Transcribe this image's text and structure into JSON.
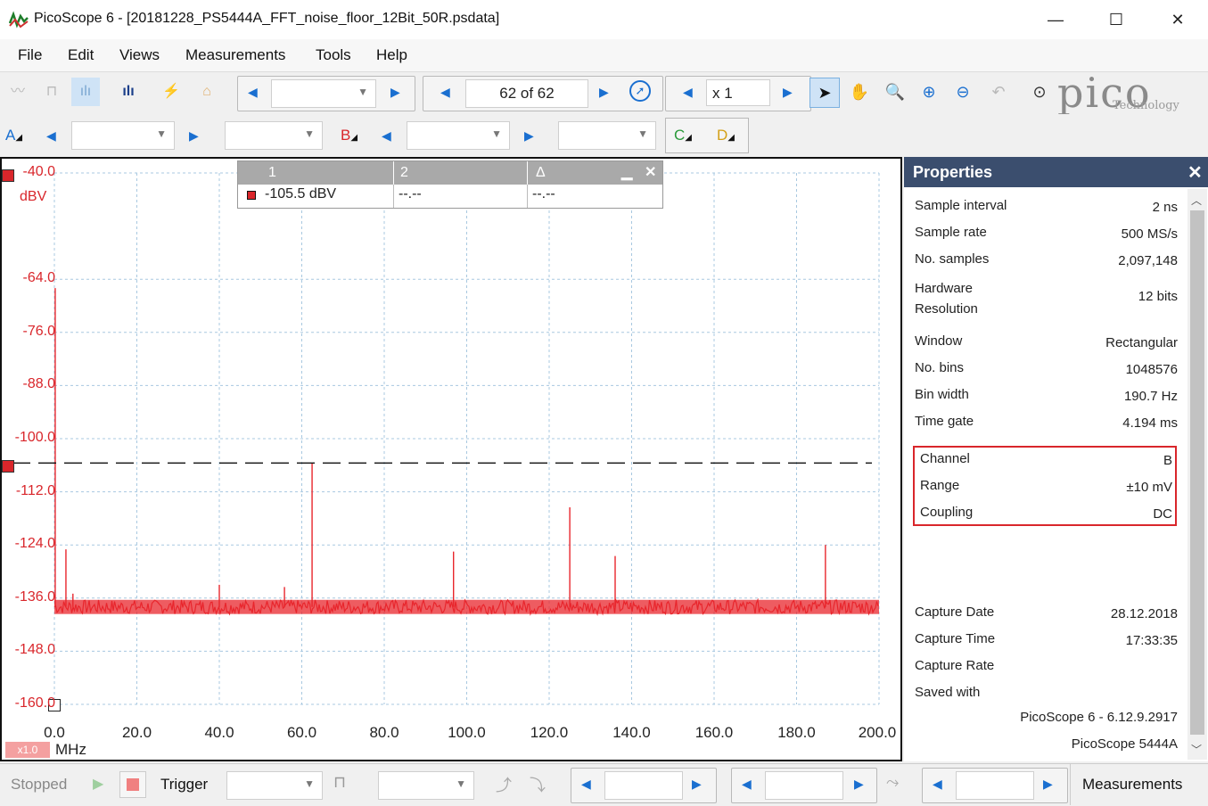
{
  "window": {
    "title": "PicoScope 6 - [20181228_PS5444A_FFT_noise_floor_12Bit_50R.psdata]",
    "minimize_icon": "minimize-icon",
    "maximize_icon": "maximize-icon",
    "close_icon": "close-icon"
  },
  "menu": [
    "File",
    "Edit",
    "Views",
    "Measurements",
    "Tools",
    "Help"
  ],
  "toolbar": {
    "buffer_position": "62 of 62",
    "zoom_value": "x 1",
    "logo_text": "pico",
    "logo_subtext": "Technology"
  },
  "channels": {
    "a": "A",
    "b": "B",
    "c": "C",
    "d": "D"
  },
  "graph": {
    "y_unit": "dBV",
    "x_unit": "MHz",
    "zoom_badge": "x1.0",
    "y_ticks": [
      "-40.0",
      "-64.0",
      "-76.0",
      "-88.0",
      "-100.0",
      "-112.0",
      "-124.0",
      "-136.0",
      "-148.0",
      "-160.0"
    ],
    "x_ticks": [
      "0.0",
      "20.0",
      "40.0",
      "60.0",
      "80.0",
      "100.0",
      "120.0",
      "140.0",
      "160.0",
      "180.0",
      "200.0"
    ],
    "colors": {
      "trace": "#e8262c",
      "grid": "#a8c8e0"
    }
  },
  "chart_data": {
    "type": "line",
    "xlabel": "MHz",
    "ylabel": "dBV",
    "xlim": [
      0,
      200
    ],
    "ylim": [
      -160,
      -40
    ],
    "grid": true,
    "noise_floor_dbv": -138,
    "ruler_dbv": -105.5,
    "spurs": [
      {
        "x": 0.2,
        "y": -66
      },
      {
        "x": 2.8,
        "y": -125
      },
      {
        "x": 4.5,
        "y": -135
      },
      {
        "x": 40.0,
        "y": -133
      },
      {
        "x": 55.8,
        "y": -133.5
      },
      {
        "x": 62.5,
        "y": -105.5
      },
      {
        "x": 96.8,
        "y": -125.5
      },
      {
        "x": 125.0,
        "y": -115.5
      },
      {
        "x": 136.0,
        "y": -126.5
      },
      {
        "x": 187.0,
        "y": -124
      }
    ]
  },
  "measurements": {
    "headers": [
      "1",
      "2",
      "Δ"
    ],
    "values": [
      "-105.5 dBV",
      "--.--",
      "--.--"
    ]
  },
  "properties": {
    "title": "Properties",
    "groups": [
      [
        {
          "label": "Sample interval",
          "value": "2 ns"
        },
        {
          "label": "Sample rate",
          "value": "500 MS/s"
        },
        {
          "label": "No. samples",
          "value": "2,097,148"
        },
        {
          "label": "Hardware Resolution",
          "value": "12 bits"
        }
      ],
      [
        {
          "label": "Window",
          "value": "Rectangular"
        },
        {
          "label": "No. bins",
          "value": "1048576"
        },
        {
          "label": "Bin width",
          "value": "190.7 Hz"
        },
        {
          "label": "Time gate",
          "value": "4.194 ms"
        }
      ]
    ],
    "channel": [
      {
        "label": "Channel",
        "value": "B"
      },
      {
        "label": "Range",
        "value": "±10 mV"
      },
      {
        "label": "Coupling",
        "value": "DC"
      }
    ],
    "capture": [
      {
        "label": "Capture Date",
        "value": "28.12.2018"
      },
      {
        "label": "Capture Time",
        "value": "17:33:35"
      },
      {
        "label": "Capture Rate",
        "value": ""
      },
      {
        "label": "Saved with",
        "value": ""
      }
    ],
    "saved_with_app": "PicoScope 6 - 6.12.9.2917",
    "saved_with_device": "PicoScope 5444A"
  },
  "status": {
    "state": "Stopped",
    "trigger_label": "Trigger",
    "measurements_label": "Measurements"
  }
}
